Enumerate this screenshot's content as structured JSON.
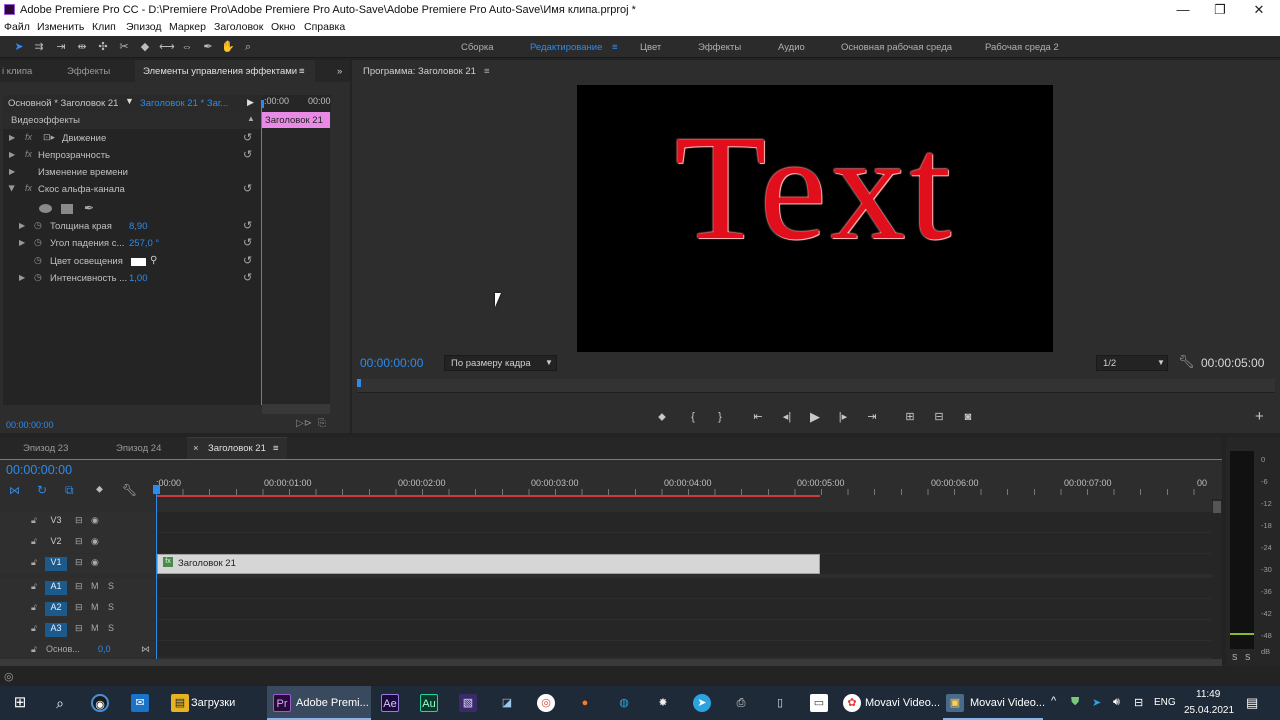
{
  "window": {
    "title": "Adobe Premiere Pro CC - D:\\Premiere Pro\\Adobe Premiere Pro Auto-Save\\Adobe Premiere Pro Auto-Save\\Имя клипа.prproj *",
    "minimize": "—",
    "maximize": "❐",
    "close": "✕"
  },
  "menu": [
    "Файл",
    "Изменить",
    "Клип",
    "Эпизод",
    "Маркер",
    "Заголовок",
    "Окно",
    "Справка"
  ],
  "workspaces": [
    "Сборка",
    "Редактирование",
    "Цвет",
    "Эффекты",
    "Аудио",
    "Основная рабочая среда",
    "Рабочая среда 2"
  ],
  "workspace_menu_icon": "≡",
  "effects_panel": {
    "tab_clip": "i клипа",
    "tab_effects": "Эффекты",
    "tab_controls": "Элементы управления эффектами",
    "menu_icon": "≡",
    "expand_icon": "»",
    "source_label": "Основной * Заголовок 21",
    "sequence_label": "Заголовок 21 * Заг...",
    "time_start": ":00:00",
    "time_end": "00:00",
    "clip_label": "Заголовок 21",
    "video_effects_header": "Видеоэффекты",
    "effects": [
      {
        "name": "Движение"
      },
      {
        "name": "Непрозрачность"
      },
      {
        "name": "Изменение времени"
      },
      {
        "name": "Скос альфа-канала"
      }
    ],
    "params": [
      {
        "name": "Толщина края",
        "value": "8,90"
      },
      {
        "name": "Угол падения с...",
        "value": "257,0 °"
      },
      {
        "name": "Цвет освещения",
        "value": ""
      },
      {
        "name": "Интенсивность ...",
        "value": "1,00"
      }
    ],
    "bottom_timecode": "00:00:00:00"
  },
  "program": {
    "title": "Программа: Заголовок 21",
    "menu_icon": "≡",
    "title_text": "Text",
    "current_time": "00:00:00:00",
    "fit": "По размеру кадра",
    "resolution": "1/2",
    "duration": "00:00:05:00",
    "add_icon": "+"
  },
  "timeline": {
    "tabs": [
      "Эпизод 23",
      "Эпизод 24",
      "Заголовок 21"
    ],
    "close_icon": "×",
    "menu_icon": "≡",
    "timecode": "00:00:00:00",
    "ruler": [
      ":00:00",
      "00:00:01:00",
      "00:00:02:00",
      "00:00:03:00",
      "00:00:04:00",
      "00:00:05:00",
      "00:00:06:00",
      "00:00:07:00",
      "00"
    ],
    "tracks": [
      {
        "name": "V3",
        "kind": "video"
      },
      {
        "name": "V2",
        "kind": "video"
      },
      {
        "name": "V1",
        "kind": "video",
        "selected": true
      },
      {
        "name": "A1",
        "kind": "audio"
      },
      {
        "name": "A2",
        "kind": "audio"
      },
      {
        "name": "A3",
        "kind": "audio"
      }
    ],
    "master_label": "Основ...",
    "master_value": "0,0",
    "clip_name": "Заголовок 21",
    "mute": "M",
    "solo": "S"
  },
  "audio_meter": {
    "db_labels": [
      "0",
      "-6",
      "-12",
      "-18",
      "-24",
      "-30",
      "-36",
      "-42",
      "-48",
      "dB"
    ],
    "solo_buttons": [
      "S",
      "S"
    ]
  },
  "taskbar": {
    "apps": [
      "Загрузки",
      "Adobe Premi...",
      "Movavi Video...",
      "Movavi Video..."
    ],
    "lang": "ENG",
    "time": "11:49",
    "date": "25.04.2021"
  },
  "colors": {
    "accent": "#2d8ceb",
    "clip_pink": "#e98be6",
    "title_red": "#e10f1c"
  }
}
